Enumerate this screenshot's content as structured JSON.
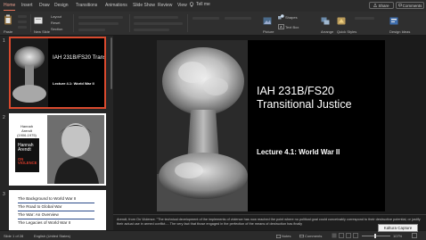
{
  "tabs": {
    "home": "Home",
    "insert": "Insert",
    "draw": "Draw",
    "design": "Design",
    "transitions": "Transitions",
    "animations": "Animations",
    "slide_show": "Slide Show",
    "review": "Review",
    "view": "View"
  },
  "tell_me": "Tell me",
  "share_label": "Share",
  "comments_label": "Comments",
  "ribbon": {
    "paste": "Paste",
    "layout": "Layout",
    "reset": "Reset",
    "new_slide": "New Slide",
    "section": "Section",
    "picture": "Picture",
    "shapes": "Shapes",
    "text_box": "Text Box",
    "arrange": "Arrange",
    "quick_styles": "Quick Styles",
    "design_ideas": "Design Ideas"
  },
  "thumbnails": [
    {
      "number": "1",
      "title": "IAH 231B/FS20 Transitional Justice",
      "subtitle": "Lecture 4.1: World War II"
    },
    {
      "number": "2",
      "caption_name": "Hannah Arendt",
      "caption_years": "(1906-1975)",
      "book_author": "Hannah Arendt",
      "book_title": "ON VIOLENCE"
    },
    {
      "number": "3",
      "items": [
        "The Background to World War II",
        "The Road to Global War",
        "The War: An Overview",
        "The Legacies of World War II"
      ]
    }
  ],
  "slide": {
    "title": "IAH 231B/FS20\nTransitional Justice",
    "subtitle": "Lecture 4.1: World War II"
  },
  "notes": "Arendt, from On Violence. \"The technical development of the implements of violence has now reached the point where no political goal could conceivably correspond to their destructive potential, or justify their actual use in armed conflict.... The very fact that those engaged in the perfection of the means of destruction has finally",
  "status": {
    "slide_count": "Slide 1 of 28",
    "language": "English (United States)",
    "notes_label": "Notes",
    "comments_label": "Comments",
    "zoom": "107%"
  },
  "tooltip": "Kaltura Capture",
  "colors": {
    "accent": "#d94a2e",
    "background": "#1e1e1e"
  }
}
